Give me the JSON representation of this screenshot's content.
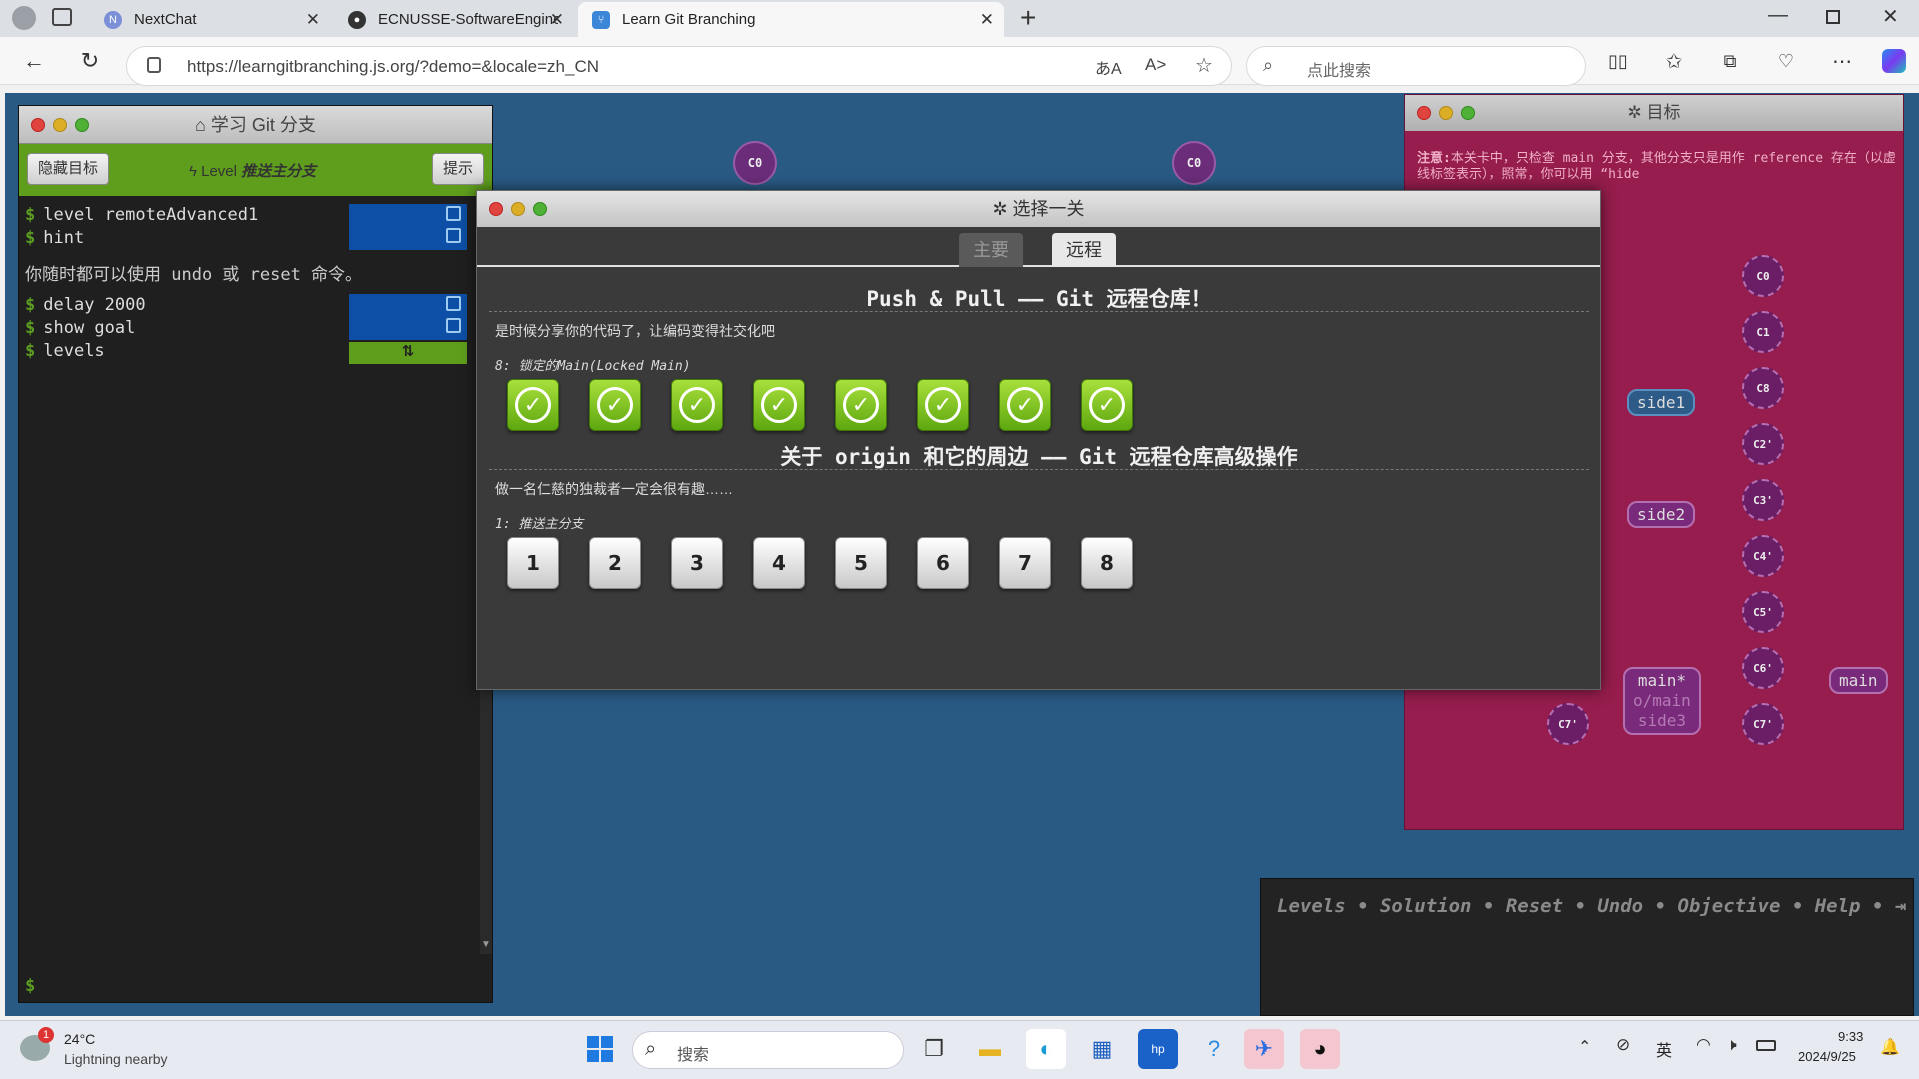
{
  "browser": {
    "tabs": [
      {
        "title": "NextChat",
        "icon": "nextchat-icon"
      },
      {
        "title": "ECNUSSE-SoftwareEngineering/a",
        "icon": "github-icon"
      },
      {
        "title": "Learn Git Branching",
        "icon": "git-icon"
      }
    ],
    "url": "https://learngitbranching.js.org/?demo=&locale=zh_CN",
    "search_placeholder": "点此搜索"
  },
  "terminal": {
    "title": "学习 Git 分支",
    "hide_goal": "隐藏目标",
    "level_prefix": "Level",
    "level_name": "推送主分支",
    "hint_button": "提示",
    "commands": [
      "level remoteAdvanced1",
      "hint",
      "delay 2000",
      "show goal",
      "levels"
    ],
    "info_line": "你随时都可以使用 undo 或 reset 命令。",
    "prompt": "$"
  },
  "canvas": {
    "nodes": [
      "C0",
      "C0"
    ]
  },
  "goal": {
    "title": "目标",
    "note_label": "注意:",
    "note_text": "本关卡中，只检查 main 分支，其他分支只是用作 reference 存在（以虚线标签表示），照常，你可以用 “hide",
    "commits": [
      "C0",
      "C1",
      "C8",
      "C2'",
      "C3'",
      "C4'",
      "C5'",
      "C6'",
      "C7'",
      "C7'"
    ],
    "labels": [
      "side1",
      "side2",
      "main*",
      "o/main",
      "side3",
      "main"
    ]
  },
  "command_bar": {
    "links": [
      "Levels",
      "Solution",
      "Reset",
      "Undo",
      "Objective",
      "Help"
    ]
  },
  "dialog": {
    "title": "选择一关",
    "tabs": [
      "主要",
      "远程"
    ],
    "active_tab": "远程",
    "sections": [
      {
        "heading": "Push & Pull —— Git 远程仓库！",
        "description": "是时候分享你的代码了，让编码变得社交化吧",
        "selected": "8: 锁定的Main(Locked Main)",
        "levels": [
          "1",
          "2",
          "3",
          "4",
          "5",
          "6",
          "7",
          "8"
        ],
        "completed": true
      },
      {
        "heading": "关于 origin 和它的周边 —— Git 远程仓库高级操作",
        "description": "做一名仁慈的独裁者一定会很有趣……",
        "selected": "1: 推送主分支",
        "levels": [
          "1",
          "2",
          "3",
          "4",
          "5",
          "6",
          "7",
          "8"
        ],
        "completed": false
      }
    ]
  },
  "taskbar": {
    "weather_temp": "24°C",
    "weather_desc": "Lightning nearby",
    "weather_badge": "1",
    "search_label": "搜索",
    "ime": "英",
    "time": "9:33",
    "date": "2024/9/25"
  },
  "colors": {
    "page_bg": "#295a84",
    "goal_bg": "#961d4d",
    "dialog_bg": "#3a3a3a",
    "level_done": "#7cc221"
  }
}
